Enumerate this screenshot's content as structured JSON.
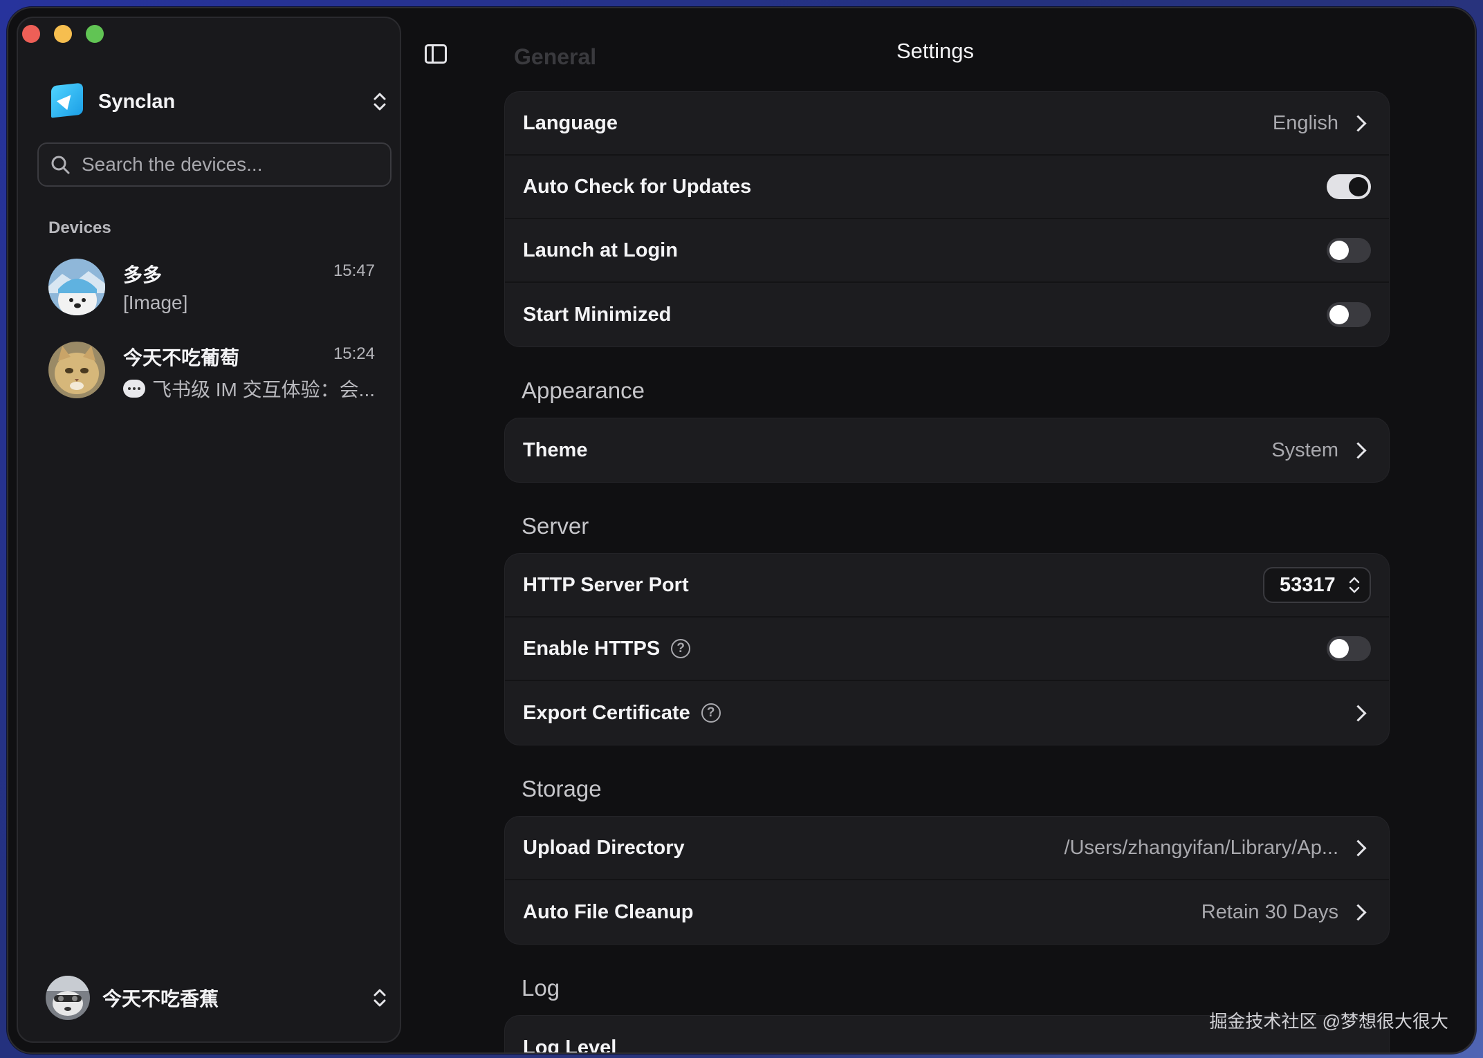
{
  "window": {
    "title": "Settings",
    "faded_section": "General"
  },
  "sidebar": {
    "app_name": "Synclan",
    "search_placeholder": "Search the devices...",
    "devices_label": "Devices",
    "devices": [
      {
        "name": "多多",
        "time": "15:47",
        "preview": "[Image]"
      },
      {
        "name": "今天不吃葡萄",
        "time": "15:24",
        "preview": "飞书级 IM 交互体验：会..."
      }
    ],
    "current_user": "今天不吃香蕉"
  },
  "settings": {
    "general": {
      "language_label": "Language",
      "language_value": "English",
      "auto_update_label": "Auto Check for Updates",
      "auto_update_on": true,
      "launch_login_label": "Launch at Login",
      "launch_login_on": false,
      "start_minimized_label": "Start Minimized",
      "start_minimized_on": false
    },
    "appearance": {
      "title": "Appearance",
      "theme_label": "Theme",
      "theme_value": "System"
    },
    "server": {
      "title": "Server",
      "port_label": "HTTP Server Port",
      "port_value": "53317",
      "https_label": "Enable HTTPS",
      "https_on": false,
      "export_cert_label": "Export Certificate"
    },
    "storage": {
      "title": "Storage",
      "upload_dir_label": "Upload Directory",
      "upload_dir_value": "/Users/zhangyifan/Library/Ap...",
      "cleanup_label": "Auto File Cleanup",
      "cleanup_value": "Retain 30 Days"
    },
    "log": {
      "title": "Log",
      "level_label": "Log Level"
    }
  },
  "watermark": "掘金技术社区 @梦想很大很大"
}
